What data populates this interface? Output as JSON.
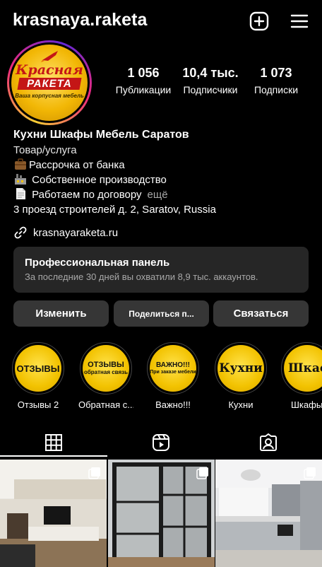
{
  "header": {
    "username": "krasnaya.raketa",
    "icons": [
      "plus-square-icon",
      "hamburger-menu-icon"
    ]
  },
  "avatar": {
    "line1": "Красная",
    "line2": "РАКЕТА",
    "line3": "Ваша корпусная мебель"
  },
  "stats": [
    {
      "value": "1 056",
      "label": "Публикации"
    },
    {
      "value": "10,4 тыс.",
      "label": "Подписчики"
    },
    {
      "value": "1 073",
      "label": "Подписки"
    }
  ],
  "bio": {
    "name": "Кухни Шкафы Мебель Саратов",
    "category": "Товар/услуга",
    "lines": [
      {
        "icon": "briefcase-emoji-icon",
        "text": "Рассрочка от банка"
      },
      {
        "icon": "factory-emoji-icon",
        "text": " Собственное производство"
      },
      {
        "icon": "document-emoji-icon",
        "text": " Работаем по договору"
      }
    ],
    "more": "ещё",
    "address": "3 проезд строителей д. 2, Saratov, Russia"
  },
  "link": {
    "icon": "link-icon",
    "text": "krasnayaraketa.ru"
  },
  "pro_panel": {
    "title": "Профессиональная панель",
    "subtitle": "За последние 30 дней вы охватили 8,9 тыс. аккаунтов."
  },
  "buttons": {
    "edit": "Изменить",
    "share": "Поделиться п...",
    "contact": "Связаться"
  },
  "highlights": [
    {
      "cover": "ОТЗЫВЫ",
      "label": "Отзывы 2"
    },
    {
      "cover": "ОТЗЫВЫ",
      "cover_sub": "обратная связь",
      "label": "Обратная с..."
    },
    {
      "cover": "ВАЖНО!!!",
      "cover_sub": "При заказе мебели",
      "label": "Важно!!!"
    },
    {
      "cover": "Кухни",
      "label": "Кухни"
    },
    {
      "cover": "Шкаф",
      "label": "Шкафы"
    }
  ],
  "tabs": [
    {
      "icon": "grid-icon",
      "active": true
    },
    {
      "icon": "reels-icon",
      "active": false
    },
    {
      "icon": "tagged-user-icon",
      "active": false
    }
  ],
  "colors": {
    "background": "#000000",
    "panel": "#262626",
    "button": "#363636",
    "secondary_text": "#a8a8a8",
    "highlight_gold": "#f2c200",
    "brand_red": "#c41616"
  }
}
